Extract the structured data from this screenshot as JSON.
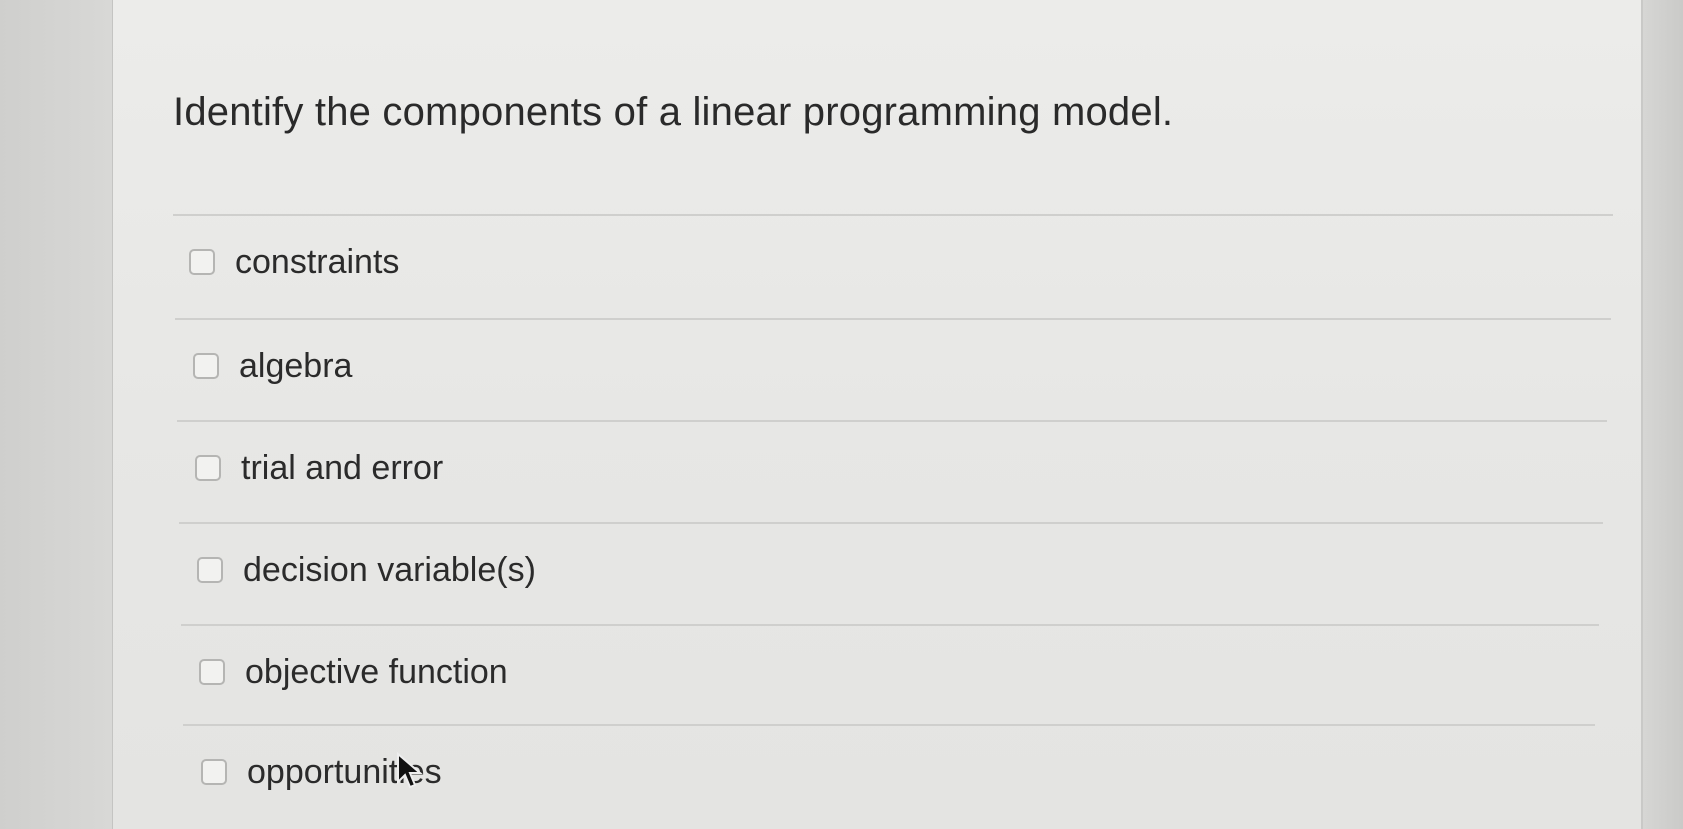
{
  "question": {
    "text": "Identify the components of a linear programming model."
  },
  "options": [
    {
      "label": "constraints",
      "checked": false
    },
    {
      "label": "algebra",
      "checked": false
    },
    {
      "label": "trial and error",
      "checked": false
    },
    {
      "label": "decision variable(s)",
      "checked": false
    },
    {
      "label": "objective function",
      "checked": false
    },
    {
      "label": "opportunities",
      "checked": false
    }
  ]
}
